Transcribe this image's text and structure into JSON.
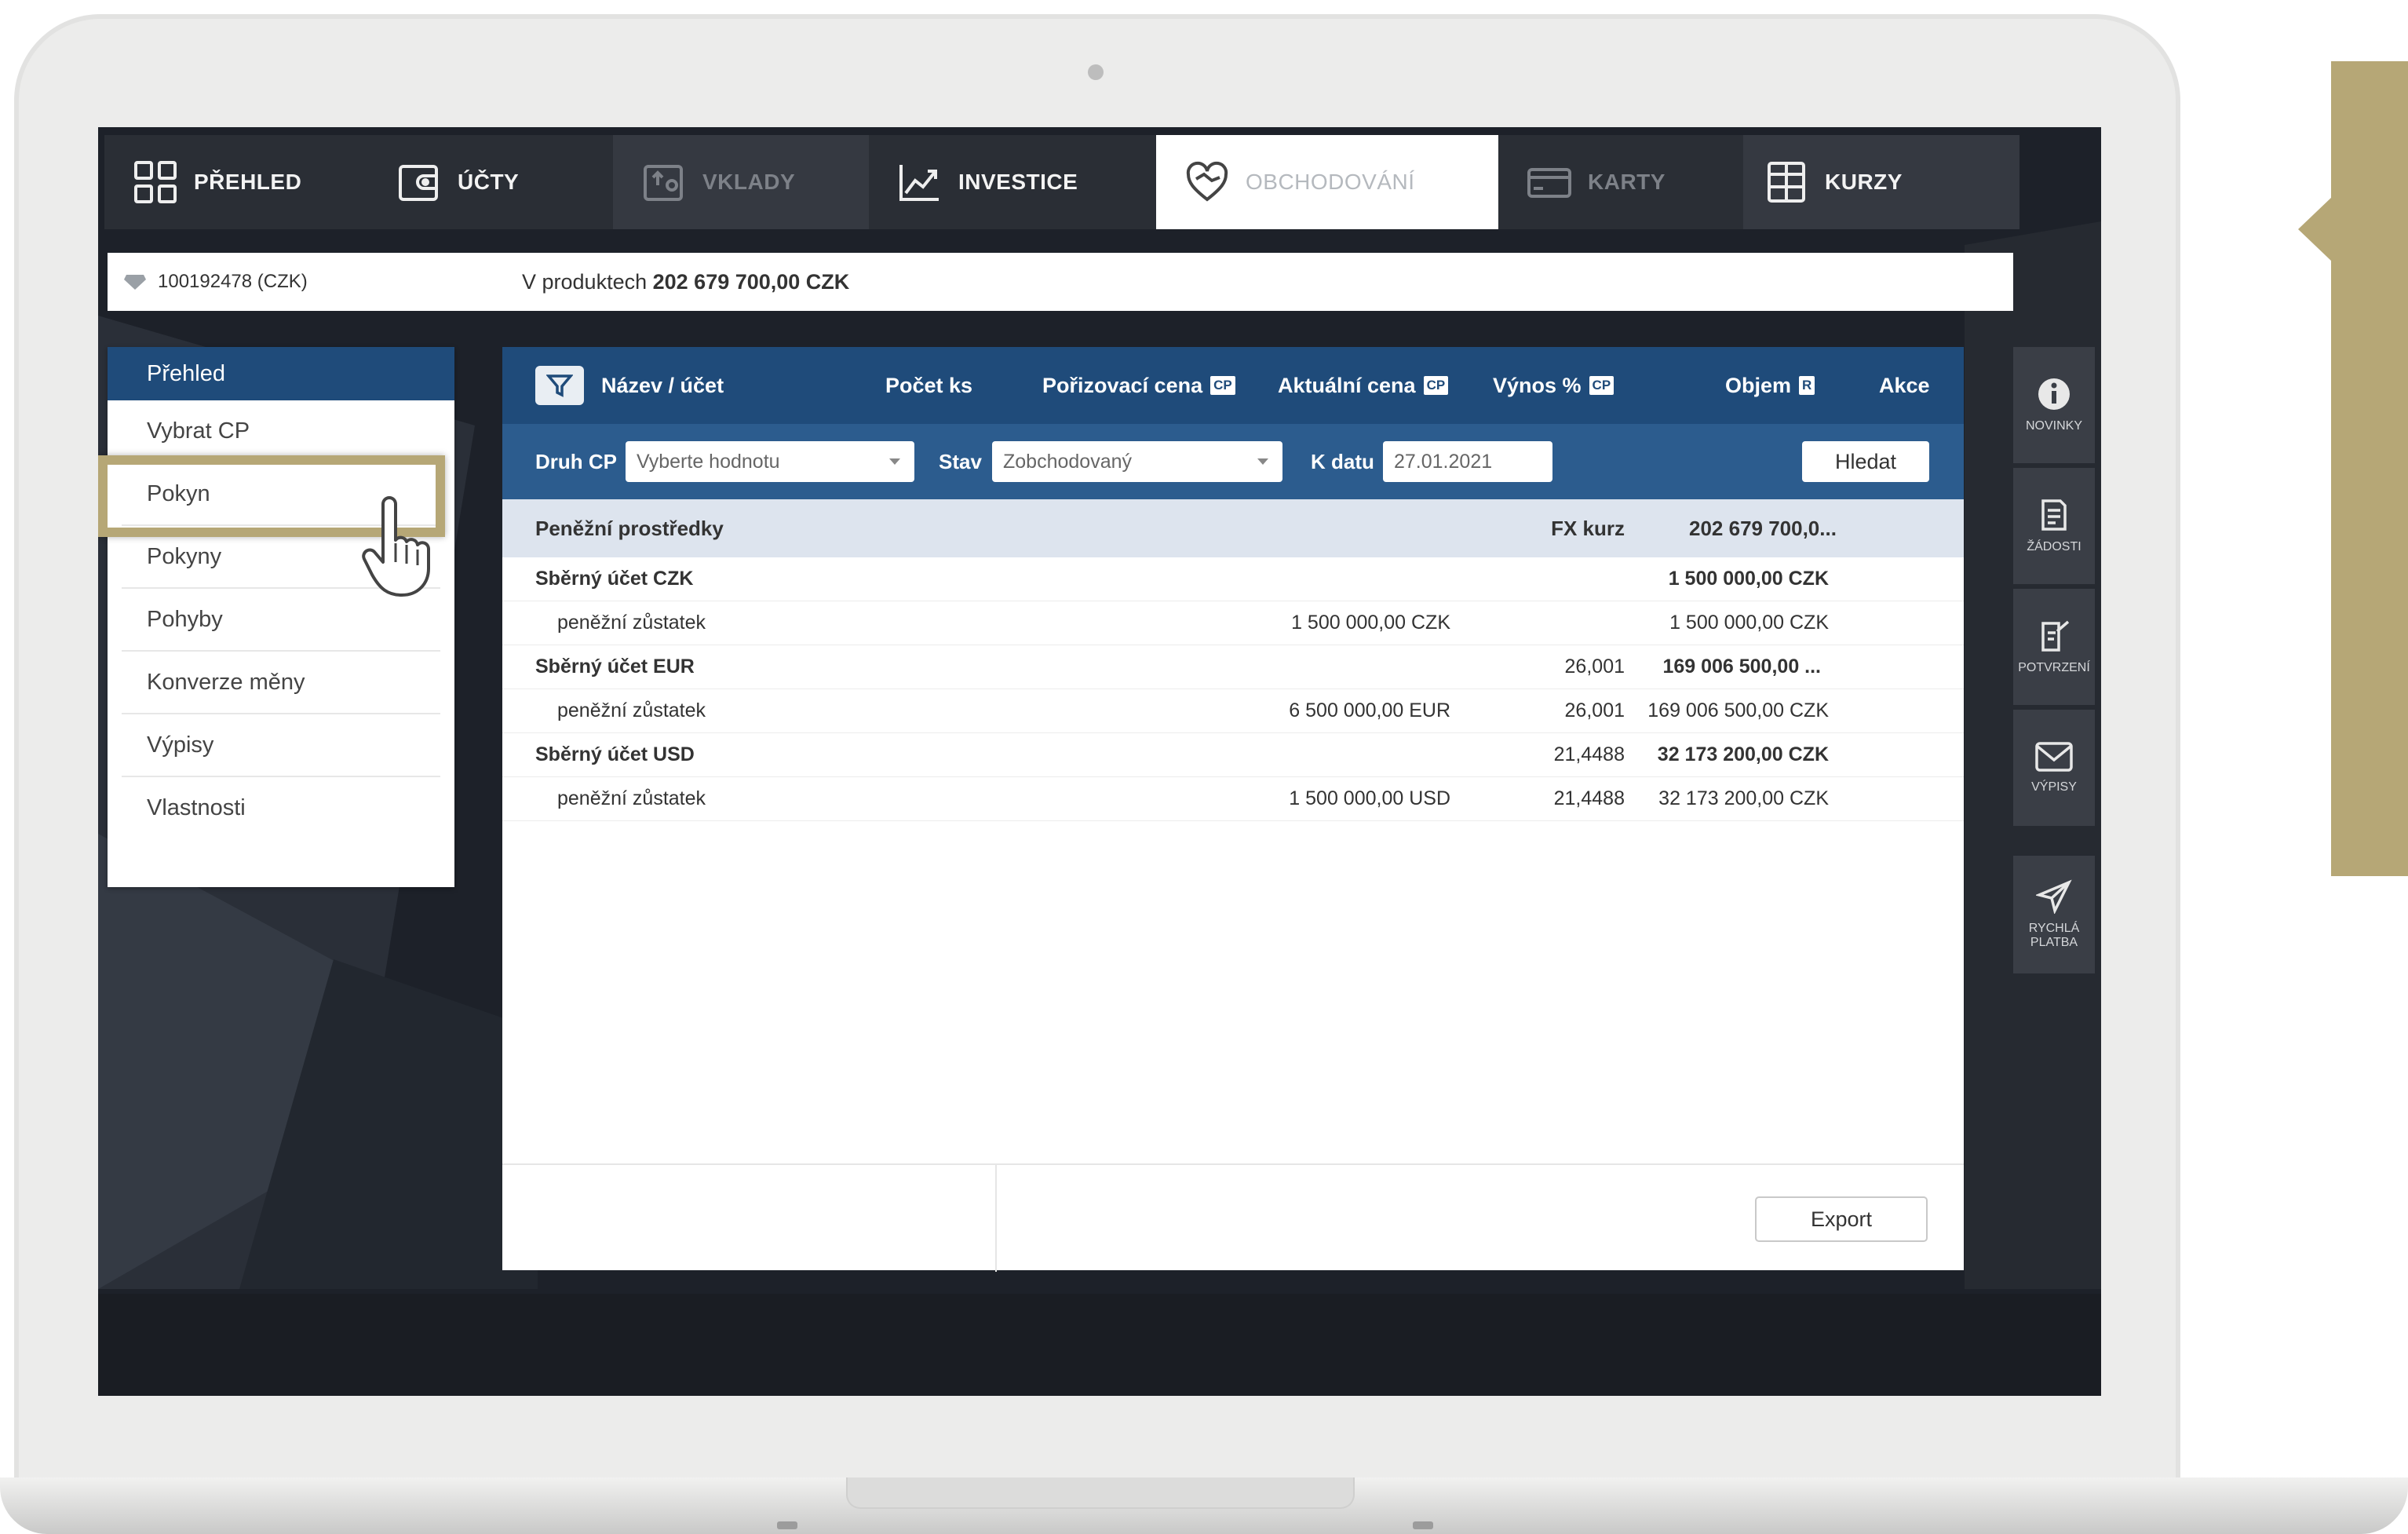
{
  "nav": {
    "tabs": [
      {
        "label": "PŘEHLED",
        "icon": "grid-icon"
      },
      {
        "label": "ÚČTY",
        "icon": "wallet-icon"
      },
      {
        "label": "VKLADY",
        "icon": "deposit-icon"
      },
      {
        "label": "INVESTICE",
        "icon": "chart-line-icon"
      },
      {
        "label": "OBCHODOVÁNÍ",
        "icon": "handshake-heart-icon"
      },
      {
        "label": "KARTY",
        "icon": "card-icon"
      },
      {
        "label": "KURZY",
        "icon": "table-icon"
      }
    ]
  },
  "account": {
    "id": "100192478 (CZK)",
    "total_prefix": "V produktech",
    "total_value": "202 679 700,00 CZK"
  },
  "menu": {
    "header": "Přehled",
    "items": [
      "Vybrat CP",
      "Pokyn",
      "Pokyny",
      "Pohyby",
      "Konverze měny",
      "Výpisy",
      "Vlastnosti"
    ]
  },
  "table": {
    "columns": {
      "name": "Název / účet",
      "count": "Počet ks",
      "purchase": "Pořizovací cena",
      "purchase_badge": "CP",
      "current": "Aktuální cena",
      "current_badge": "CP",
      "yield": "Výnos %",
      "yield_badge": "CP",
      "volume": "Objem",
      "volume_badge": "R",
      "action": "Akce"
    },
    "filters": {
      "druh_label": "Druh CP",
      "druh_placeholder": "Vyberte hodnotu",
      "stav_label": "Stav",
      "stav_value": "Zobchodovaný",
      "datum_label": "K datu",
      "datum_value": "27.01.2021",
      "search_button": "Hledat"
    },
    "group": {
      "name": "Peněžní prostředky",
      "fx_label": "FX kurz",
      "total": "202 679 700,0..."
    },
    "rows": [
      {
        "name": "Sběrný účet CZK",
        "amount": "",
        "fx": "",
        "volume": "1 500 000,00 CZK",
        "bold": true
      },
      {
        "name": "peněžní zůstatek",
        "amount": "1 500 000,00 CZK",
        "fx": "",
        "volume": "1 500 000,00 CZK",
        "bold": false
      },
      {
        "name": "Sběrný účet EUR",
        "amount": "",
        "fx": "26,001",
        "volume": "169 006 500,00 ...",
        "bold": true
      },
      {
        "name": "peněžní zůstatek",
        "amount": "6 500 000,00 EUR",
        "fx": "26,001",
        "volume": "169 006 500,00 CZK",
        "bold": false
      },
      {
        "name": "Sběrný účet USD",
        "amount": "",
        "fx": "21,4488",
        "volume": "32 173 200,00 CZK",
        "bold": true
      },
      {
        "name": "peněžní zůstatek",
        "amount": "1 500 000,00 USD",
        "fx": "21,4488",
        "volume": "32 173 200,00 CZK",
        "bold": false
      }
    ],
    "export_button": "Export"
  },
  "sidebar": {
    "items": [
      {
        "label": "NOVINKY",
        "icon": "info-icon"
      },
      {
        "label": "ŽÁDOSTI",
        "icon": "document-icon"
      },
      {
        "label": "POTVRZENÍ",
        "icon": "document-check-icon"
      },
      {
        "label": "VÝPISY",
        "icon": "mail-icon"
      },
      {
        "label": "RYCHLÁ PLATBA",
        "icon": "send-icon"
      }
    ]
  },
  "colors": {
    "primary": "#1f4b7a",
    "filter_bar": "#2c5c8e",
    "accent_gold": "#b6a776",
    "nav_bg": "#2a2e35"
  }
}
